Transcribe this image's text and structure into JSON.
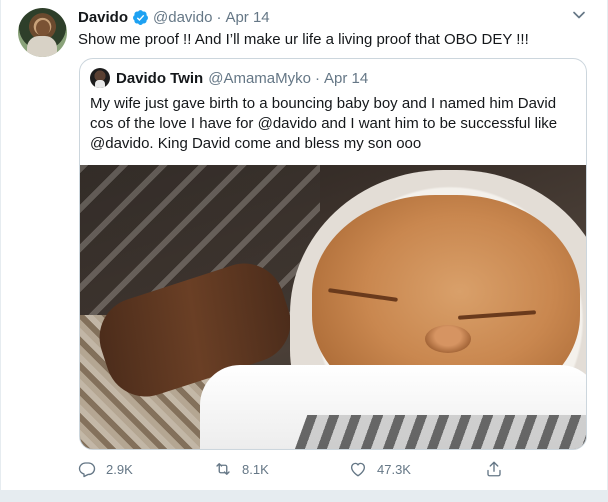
{
  "tweet": {
    "author_name": "Davido",
    "author_handle": "@davido",
    "separator": "·",
    "date": "Apr 14",
    "text": "Show me proof !! And I’ll make ur life a living proof that OBO DEY !!!",
    "verified_icon": "verified-badge-icon",
    "menu_icon": "chevron-down-icon"
  },
  "quoted_tweet": {
    "author_name": "Davido Twin",
    "author_handle": "@AmamaMyko",
    "separator": "·",
    "date": "Apr 14",
    "text": "My wife just gave birth to a bouncing baby boy and I named him David cos of the love I have for @davido and I want him to be successful like @davido. King David come and bless my son ooo",
    "media_alt": "sleeping newborn baby photo"
  },
  "actions": {
    "reply_count": "2.9K",
    "retweet_count": "8.1K",
    "like_count": "47.3K",
    "reply_icon": "reply-icon",
    "retweet_icon": "retweet-icon",
    "like_icon": "heart-icon",
    "share_icon": "share-icon"
  },
  "colors": {
    "verified_blue": "#1da1f2",
    "secondary_text": "#657786",
    "border": "#ccd6dd"
  }
}
